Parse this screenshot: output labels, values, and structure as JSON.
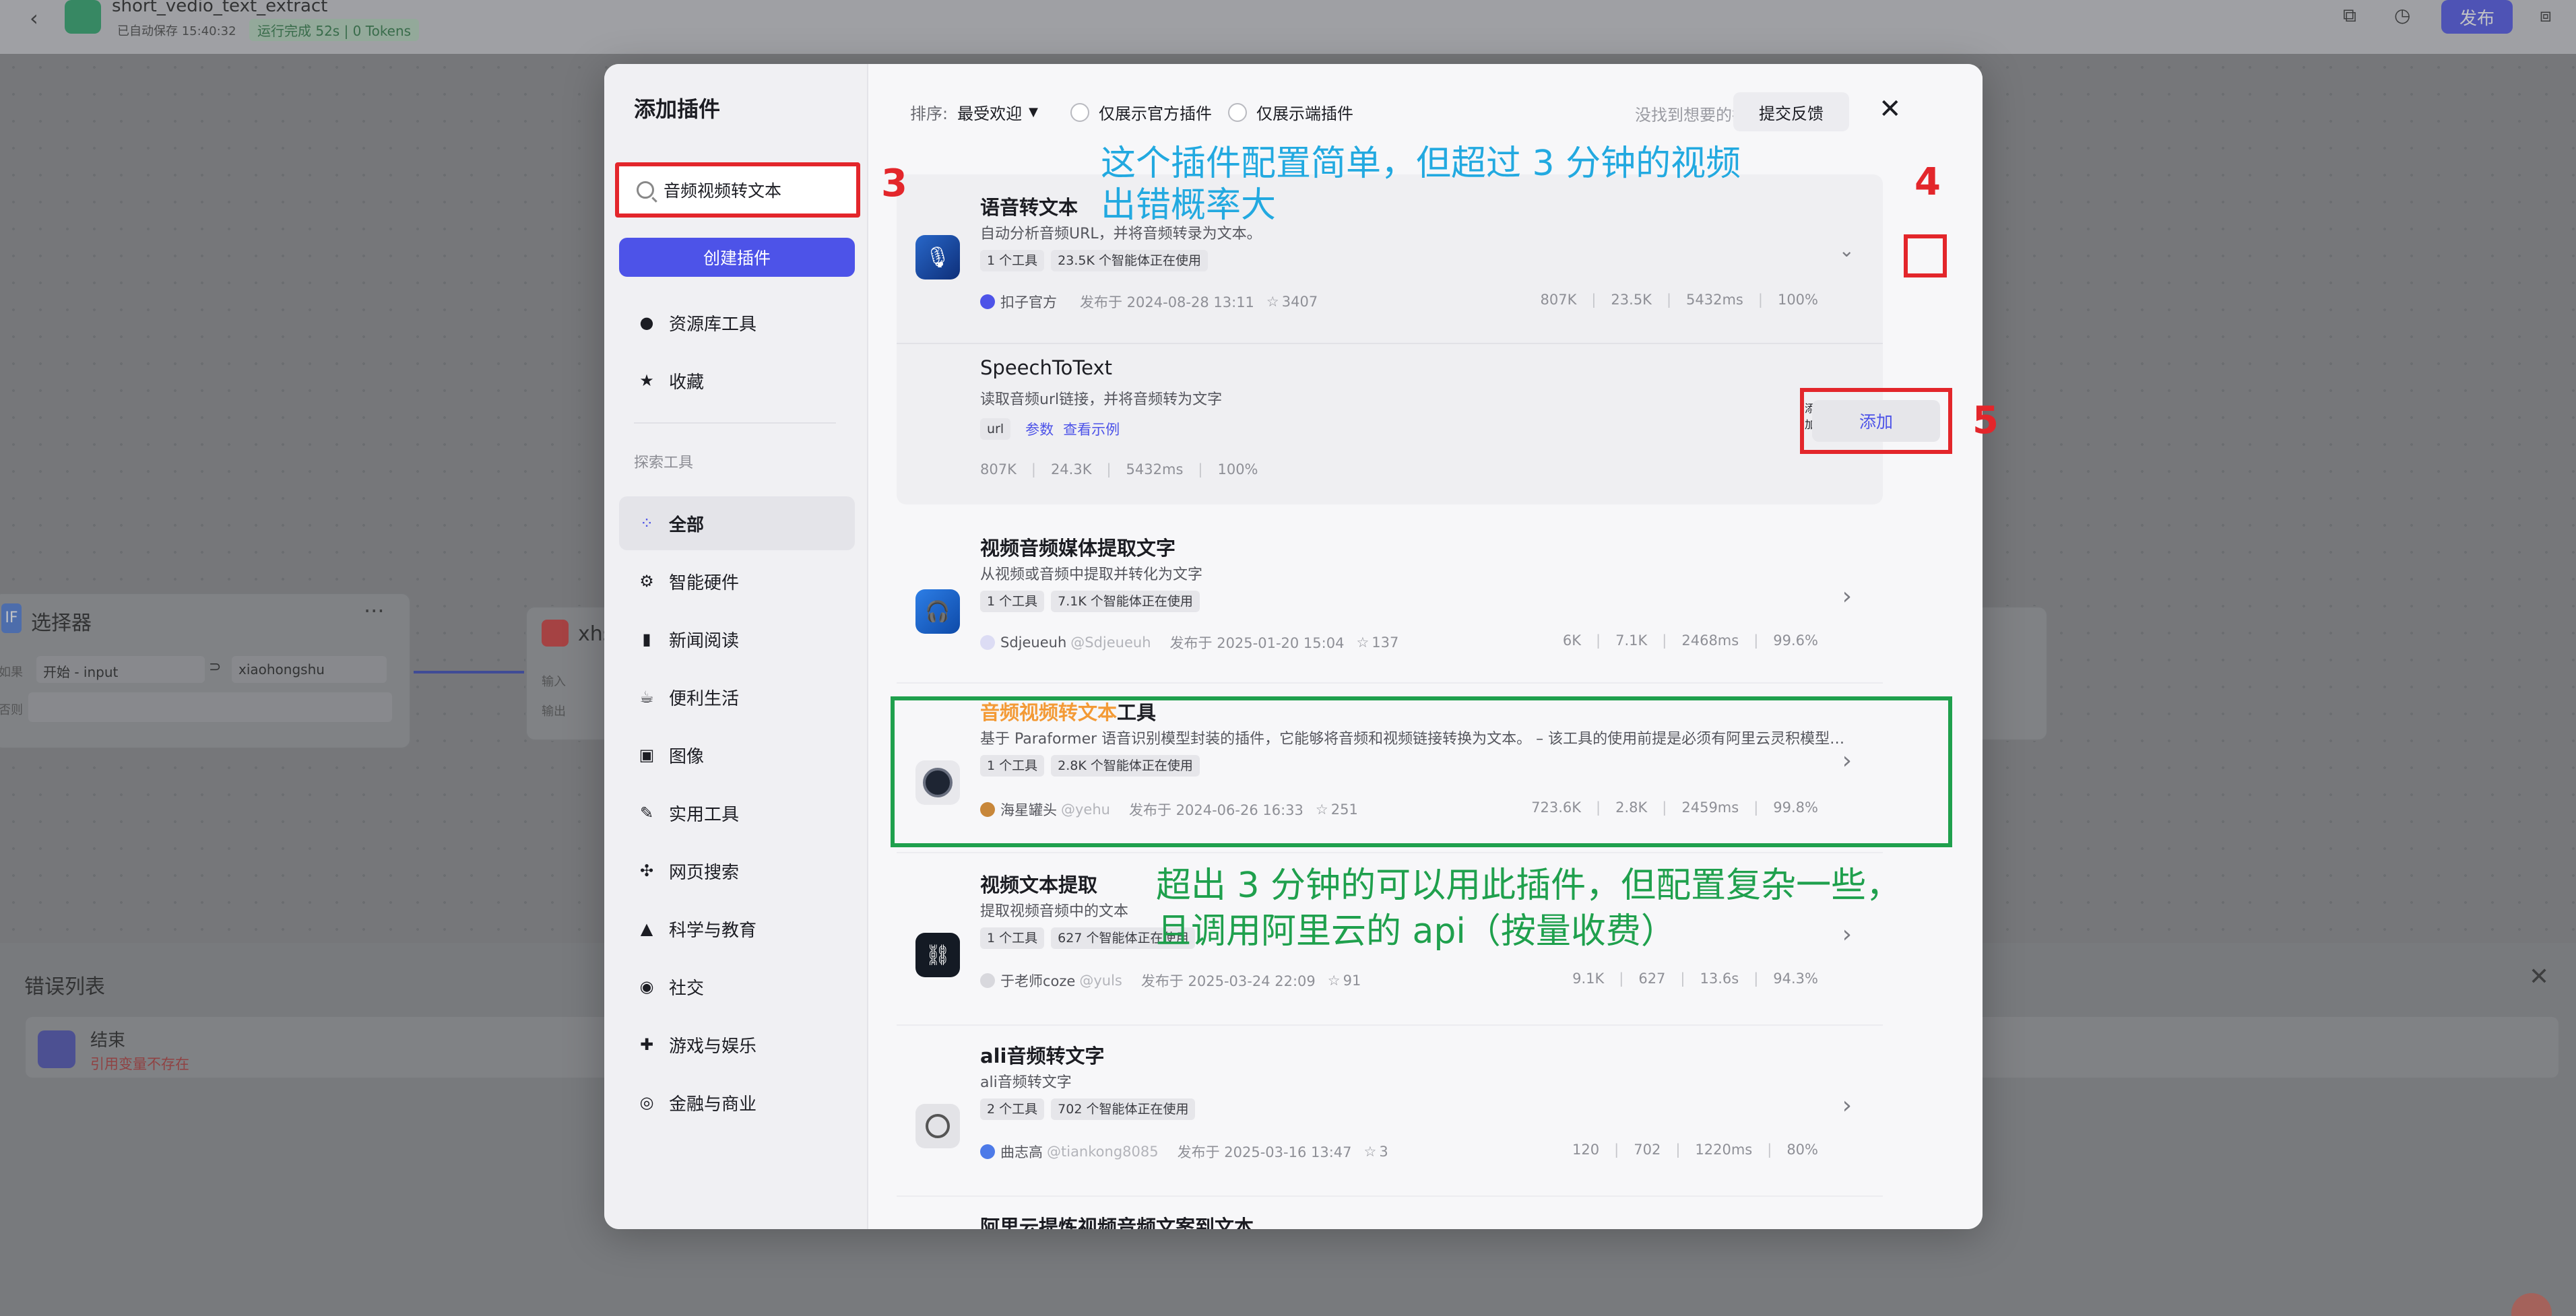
{
  "app": {
    "project_name": "short_vedio_text_extract",
    "autosave": "已自动保存 15:40:32",
    "run_status": "运行完成 52s | 0 Tokens",
    "publish_label": "发布"
  },
  "background": {
    "selector_node_title": "选择器",
    "selector_node_icon_text": "IF",
    "selector_row_label": "如果",
    "selector_row_field": "开始 - input",
    "selector_row_op": "⊃",
    "selector_row_value": "xiaohongshu",
    "selector_row2_label": "否则",
    "xhs_node_title": "xhs",
    "xhs_in": "输入",
    "xhs_out": "输出",
    "error_panel_title": "错误列表",
    "error_item_title": "结束",
    "error_item_desc": "引用变量不存在"
  },
  "modal": {
    "title": "添加插件",
    "search_value": "音频视频转文本",
    "create_label": "创建插件",
    "nav_top": [
      {
        "label": "资源库工具",
        "icon": "person-icon"
      },
      {
        "label": "收藏",
        "icon": "star-icon"
      }
    ],
    "explore_label": "探索工具",
    "categories": [
      {
        "label": "全部",
        "icon": "grid-icon",
        "active": true
      },
      {
        "label": "智能硬件",
        "icon": "chip-icon"
      },
      {
        "label": "新闻阅读",
        "icon": "book-icon"
      },
      {
        "label": "便利生活",
        "icon": "cup-icon"
      },
      {
        "label": "图像",
        "icon": "image-icon"
      },
      {
        "label": "实用工具",
        "icon": "wrench-icon"
      },
      {
        "label": "网页搜索",
        "icon": "network-icon"
      },
      {
        "label": "科学与教育",
        "icon": "cap-icon"
      },
      {
        "label": "社交",
        "icon": "chat-icon"
      },
      {
        "label": "游戏与娱乐",
        "icon": "gamepad-icon"
      },
      {
        "label": "金融与商业",
        "icon": "coins-icon"
      }
    ],
    "sort_label": "排序:",
    "sort_value": "最受欢迎",
    "filter_official": "仅展示官方插件",
    "filter_client": "仅展示端插件",
    "not_found": "没找到想要的插件?",
    "feedback_label": "提交反馈"
  },
  "plugins": [
    {
      "title": "语音转文本",
      "desc": "自动分析音频URL，并将音频转录为文本。",
      "tags": [
        "1 个工具",
        "23.5K 个智能体正在使用"
      ],
      "author": "扣子官方",
      "published": "发布于 2024-08-28 13:11",
      "stars": "3407",
      "stats": [
        "807K",
        "23.5K",
        "5432ms",
        "100%"
      ],
      "tool": {
        "name": "SpeechToText",
        "desc": "读取音频url链接，并将音频转为文字",
        "param_tag": "url",
        "params_link": "参数",
        "example_link": "查看示例",
        "stats": [
          "807K",
          "24.3K",
          "5432ms",
          "100%"
        ],
        "add_label": "添加"
      }
    },
    {
      "title": "视频音频媒体提取文字",
      "desc": "从视频或音频中提取并转化为文字",
      "tags": [
        "1 个工具",
        "7.1K 个智能体正在使用"
      ],
      "author": "Sdjeueuh",
      "handle": "@Sdjeueuh",
      "published": "发布于 2025-01-20 15:04",
      "stars": "137",
      "stats": [
        "6K",
        "7.1K",
        "2468ms",
        "99.6%"
      ]
    },
    {
      "title_highlight": "音频视频转文本",
      "title_rest": "工具",
      "desc": "基于 Paraformer 语音识别模型封装的插件，它能够将音频和视频链接转换为文本。 – 该工具的使用前提是必须有阿里云灵积模型的 apik...",
      "tags": [
        "1 个工具",
        "2.8K 个智能体正在使用"
      ],
      "author": "海星罐头",
      "handle": "@yehu",
      "published": "发布于 2024-06-26 16:33",
      "stars": "251",
      "stats": [
        "723.6K",
        "2.8K",
        "2459ms",
        "99.8%"
      ]
    },
    {
      "title": "视频文本提取",
      "desc": "提取视频音频中的文本",
      "tags": [
        "1 个工具",
        "627 个智能体正在使用"
      ],
      "author": "于老师coze",
      "handle": "@yuls",
      "published": "发布于 2025-03-24 22:09",
      "stars": "91",
      "stats": [
        "9.1K",
        "627",
        "13.6s",
        "94.3%"
      ]
    },
    {
      "title": "ali音频转文字",
      "desc": "ali音频转文字",
      "tags": [
        "2 个工具",
        "702 个智能体正在使用"
      ],
      "author": "曲志高",
      "handle": "@tiankong8085",
      "published": "发布于 2025-03-16 13:47",
      "stars": "3",
      "stats": [
        "120",
        "702",
        "1220ms",
        "80%"
      ]
    },
    {
      "title": "阿里云提炼视频音频文案到文本"
    }
  ],
  "annotations": {
    "n3": "3",
    "n4": "4",
    "n5": "5",
    "note_blue_1": "这个插件配置简单，但超过 3 分钟的视频",
    "note_blue_2": "出错概率大",
    "note_green_1": "超出 3 分钟的可以用此插件，但配置复杂一些，",
    "note_green_2": "且调用阿里云的 api（按量收费）",
    "colors": {
      "red": "#e3262b",
      "blue": "#22a9e0",
      "green": "#1fa04d",
      "accent": "#4d53e8",
      "highlight": "#f39a36"
    }
  }
}
